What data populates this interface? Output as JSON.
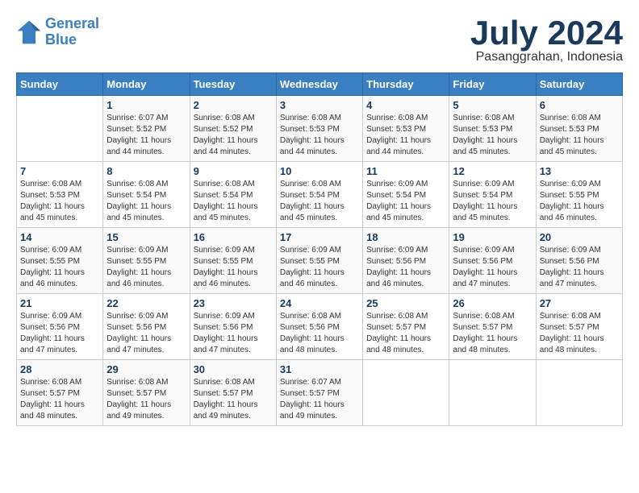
{
  "logo": {
    "text_general": "General",
    "text_blue": "Blue"
  },
  "title": "July 2024",
  "subtitle": "Pasanggrahan, Indonesia",
  "days_of_week": [
    "Sunday",
    "Monday",
    "Tuesday",
    "Wednesday",
    "Thursday",
    "Friday",
    "Saturday"
  ],
  "weeks": [
    [
      {
        "day": "",
        "info": ""
      },
      {
        "day": "1",
        "info": "Sunrise: 6:07 AM\nSunset: 5:52 PM\nDaylight: 11 hours\nand 44 minutes."
      },
      {
        "day": "2",
        "info": "Sunrise: 6:08 AM\nSunset: 5:52 PM\nDaylight: 11 hours\nand 44 minutes."
      },
      {
        "day": "3",
        "info": "Sunrise: 6:08 AM\nSunset: 5:53 PM\nDaylight: 11 hours\nand 44 minutes."
      },
      {
        "day": "4",
        "info": "Sunrise: 6:08 AM\nSunset: 5:53 PM\nDaylight: 11 hours\nand 44 minutes."
      },
      {
        "day": "5",
        "info": "Sunrise: 6:08 AM\nSunset: 5:53 PM\nDaylight: 11 hours\nand 45 minutes."
      },
      {
        "day": "6",
        "info": "Sunrise: 6:08 AM\nSunset: 5:53 PM\nDaylight: 11 hours\nand 45 minutes."
      }
    ],
    [
      {
        "day": "7",
        "info": "Sunrise: 6:08 AM\nSunset: 5:53 PM\nDaylight: 11 hours\nand 45 minutes."
      },
      {
        "day": "8",
        "info": "Sunrise: 6:08 AM\nSunset: 5:54 PM\nDaylight: 11 hours\nand 45 minutes."
      },
      {
        "day": "9",
        "info": "Sunrise: 6:08 AM\nSunset: 5:54 PM\nDaylight: 11 hours\nand 45 minutes."
      },
      {
        "day": "10",
        "info": "Sunrise: 6:08 AM\nSunset: 5:54 PM\nDaylight: 11 hours\nand 45 minutes."
      },
      {
        "day": "11",
        "info": "Sunrise: 6:09 AM\nSunset: 5:54 PM\nDaylight: 11 hours\nand 45 minutes."
      },
      {
        "day": "12",
        "info": "Sunrise: 6:09 AM\nSunset: 5:54 PM\nDaylight: 11 hours\nand 45 minutes."
      },
      {
        "day": "13",
        "info": "Sunrise: 6:09 AM\nSunset: 5:55 PM\nDaylight: 11 hours\nand 46 minutes."
      }
    ],
    [
      {
        "day": "14",
        "info": "Sunrise: 6:09 AM\nSunset: 5:55 PM\nDaylight: 11 hours\nand 46 minutes."
      },
      {
        "day": "15",
        "info": "Sunrise: 6:09 AM\nSunset: 5:55 PM\nDaylight: 11 hours\nand 46 minutes."
      },
      {
        "day": "16",
        "info": "Sunrise: 6:09 AM\nSunset: 5:55 PM\nDaylight: 11 hours\nand 46 minutes."
      },
      {
        "day": "17",
        "info": "Sunrise: 6:09 AM\nSunset: 5:55 PM\nDaylight: 11 hours\nand 46 minutes."
      },
      {
        "day": "18",
        "info": "Sunrise: 6:09 AM\nSunset: 5:56 PM\nDaylight: 11 hours\nand 46 minutes."
      },
      {
        "day": "19",
        "info": "Sunrise: 6:09 AM\nSunset: 5:56 PM\nDaylight: 11 hours\nand 47 minutes."
      },
      {
        "day": "20",
        "info": "Sunrise: 6:09 AM\nSunset: 5:56 PM\nDaylight: 11 hours\nand 47 minutes."
      }
    ],
    [
      {
        "day": "21",
        "info": "Sunrise: 6:09 AM\nSunset: 5:56 PM\nDaylight: 11 hours\nand 47 minutes."
      },
      {
        "day": "22",
        "info": "Sunrise: 6:09 AM\nSunset: 5:56 PM\nDaylight: 11 hours\nand 47 minutes."
      },
      {
        "day": "23",
        "info": "Sunrise: 6:09 AM\nSunset: 5:56 PM\nDaylight: 11 hours\nand 47 minutes."
      },
      {
        "day": "24",
        "info": "Sunrise: 6:08 AM\nSunset: 5:56 PM\nDaylight: 11 hours\nand 48 minutes."
      },
      {
        "day": "25",
        "info": "Sunrise: 6:08 AM\nSunset: 5:57 PM\nDaylight: 11 hours\nand 48 minutes."
      },
      {
        "day": "26",
        "info": "Sunrise: 6:08 AM\nSunset: 5:57 PM\nDaylight: 11 hours\nand 48 minutes."
      },
      {
        "day": "27",
        "info": "Sunrise: 6:08 AM\nSunset: 5:57 PM\nDaylight: 11 hours\nand 48 minutes."
      }
    ],
    [
      {
        "day": "28",
        "info": "Sunrise: 6:08 AM\nSunset: 5:57 PM\nDaylight: 11 hours\nand 48 minutes."
      },
      {
        "day": "29",
        "info": "Sunrise: 6:08 AM\nSunset: 5:57 PM\nDaylight: 11 hours\nand 49 minutes."
      },
      {
        "day": "30",
        "info": "Sunrise: 6:08 AM\nSunset: 5:57 PM\nDaylight: 11 hours\nand 49 minutes."
      },
      {
        "day": "31",
        "info": "Sunrise: 6:07 AM\nSunset: 5:57 PM\nDaylight: 11 hours\nand 49 minutes."
      },
      {
        "day": "",
        "info": ""
      },
      {
        "day": "",
        "info": ""
      },
      {
        "day": "",
        "info": ""
      }
    ]
  ]
}
